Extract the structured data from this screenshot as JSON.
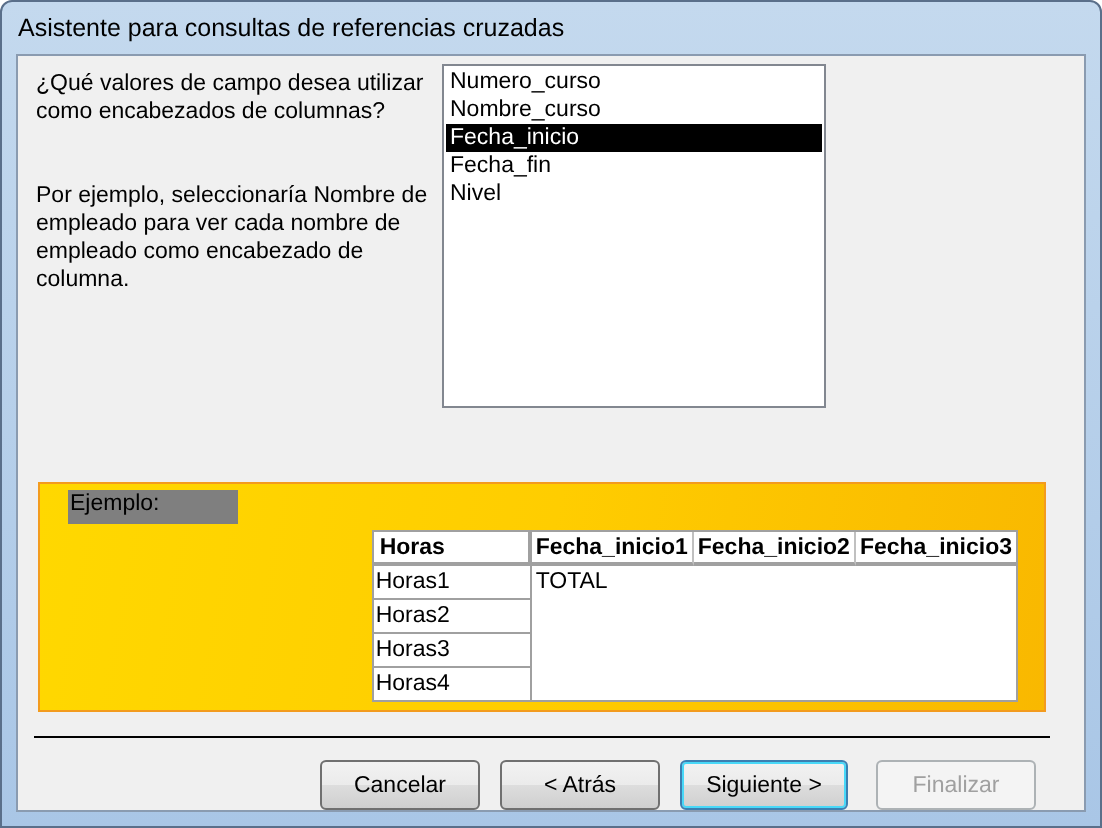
{
  "window": {
    "title": "Asistente para consultas de referencias cruzadas"
  },
  "question": "¿Qué valores de campo desea utilizar como encabezados de columnas?",
  "hint": "Por ejemplo, seleccionaría Nombre de empleado para ver cada nombre de empleado como encabezado de columna.",
  "fields": [
    {
      "label": "Numero_curso",
      "selected": false
    },
    {
      "label": "Nombre_curso",
      "selected": false
    },
    {
      "label": "Fecha_inicio",
      "selected": true
    },
    {
      "label": "Fecha_fin",
      "selected": false
    },
    {
      "label": "Nivel",
      "selected": false
    }
  ],
  "example": {
    "label": "Ejemplo:",
    "row_header": "Horas",
    "column_headers": [
      "Fecha_inicio1",
      "Fecha_inicio2",
      "Fecha_inicio3"
    ],
    "rows": [
      "Horas1",
      "Horas2",
      "Horas3",
      "Horas4"
    ],
    "value": "TOTAL"
  },
  "buttons": [
    {
      "label": "Cancelar",
      "default": false,
      "disabled": false
    },
    {
      "label": "< Atrás",
      "default": false,
      "disabled": false
    },
    {
      "label": "Siguiente >",
      "default": true,
      "disabled": false
    },
    {
      "label": "Finalizar",
      "default": false,
      "disabled": true
    }
  ]
}
